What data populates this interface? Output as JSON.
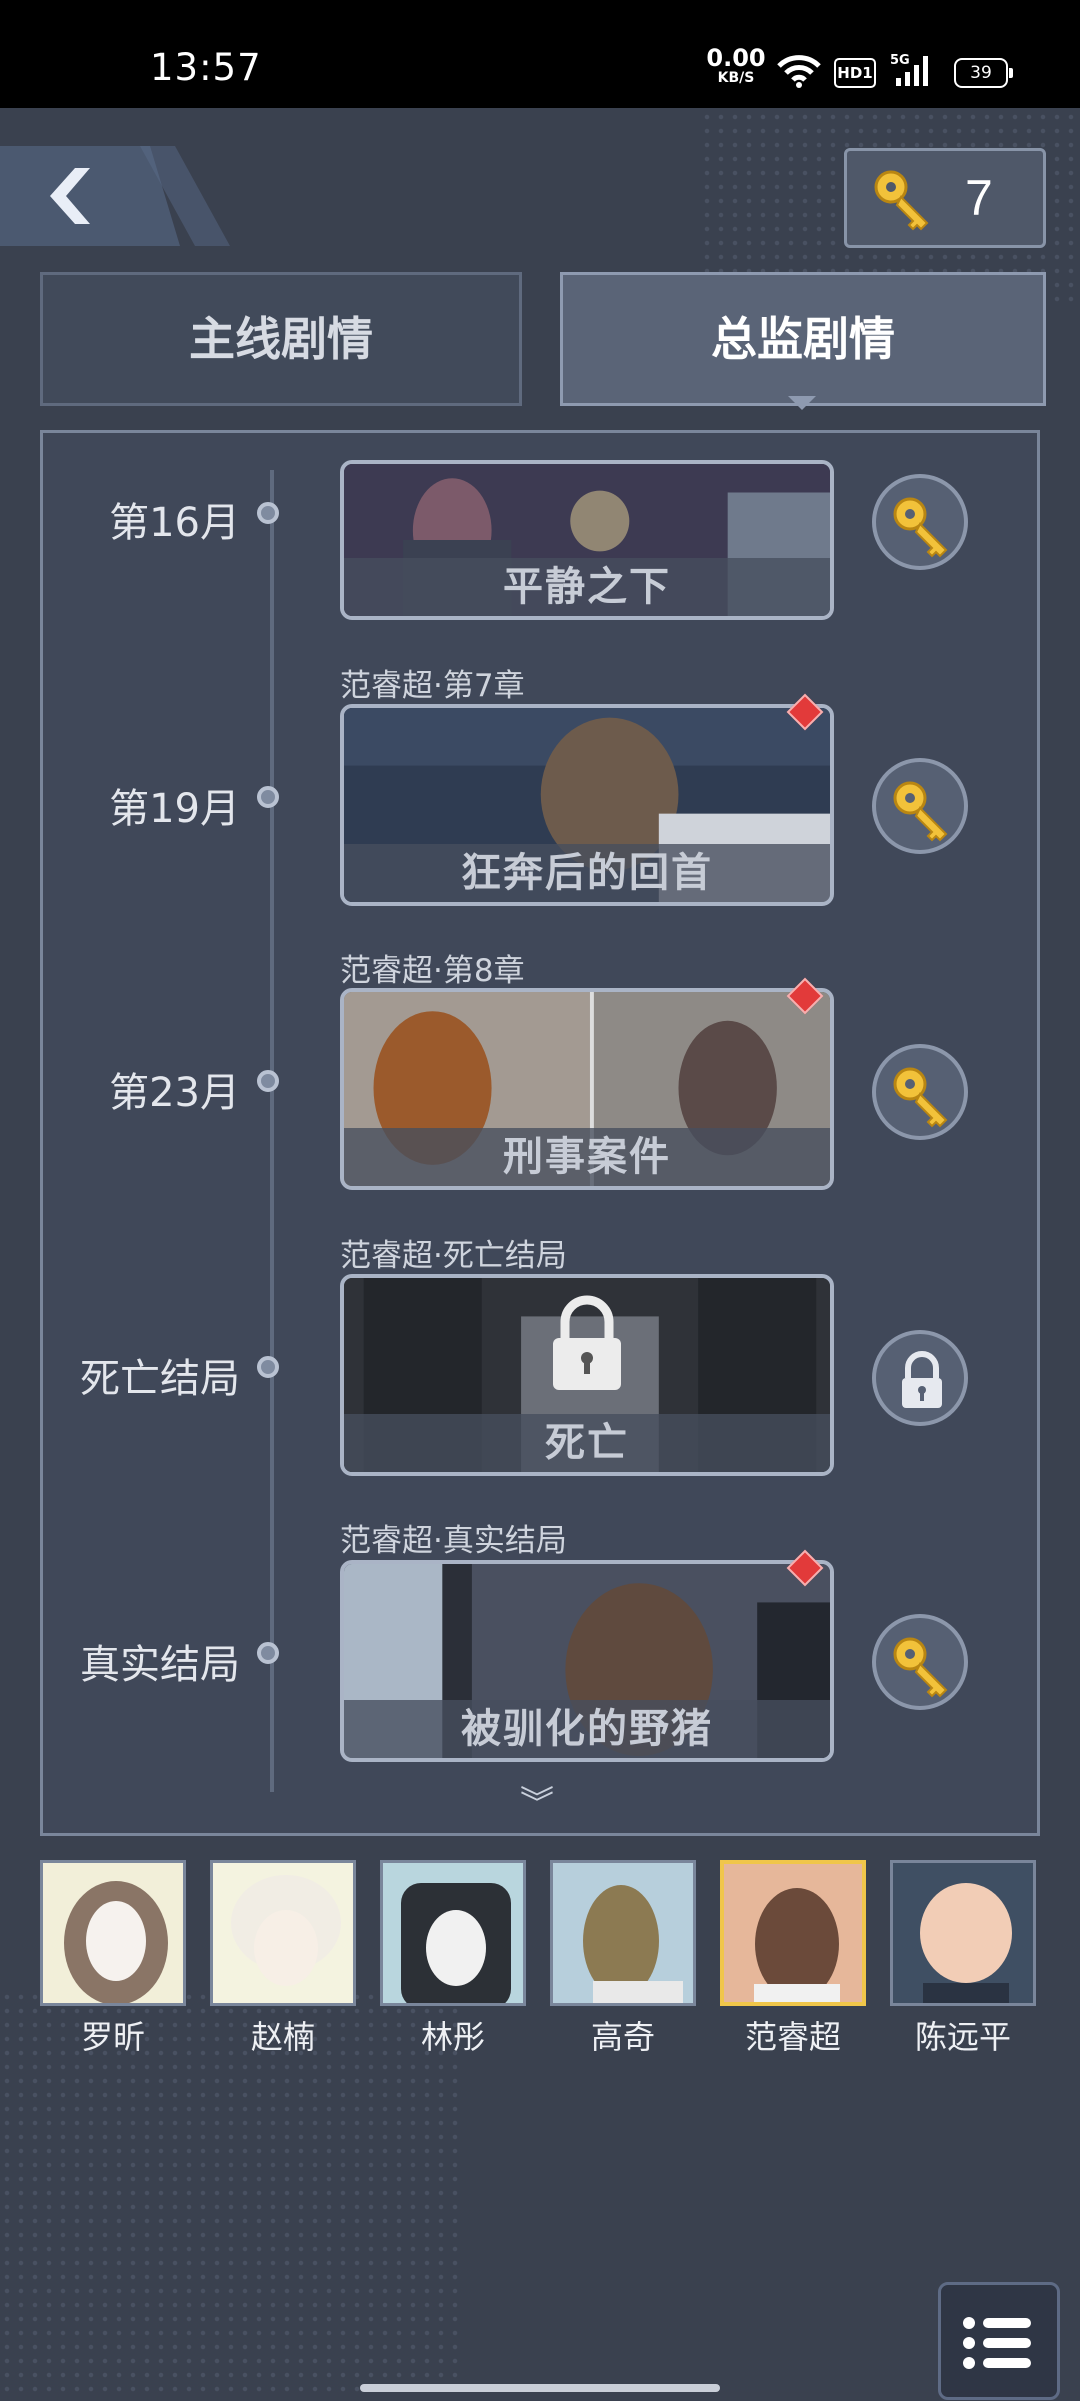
{
  "status_bar": {
    "time": "13:57",
    "net_speed": "0.00",
    "net_unit": "KB/S",
    "hd": "HD1",
    "signal": "5G",
    "battery": "39"
  },
  "header": {
    "key_count": "7"
  },
  "tabs": [
    {
      "label": "主线剧情",
      "active": false
    },
    {
      "label": "总监剧情",
      "active": true
    }
  ],
  "timeline": [
    {
      "month": "第16月",
      "subtitle": "",
      "title": "平静之下",
      "locked": false,
      "new": false
    },
    {
      "month": "第19月",
      "subtitle": "范睿超·第7章",
      "title": "狂奔后的回首",
      "locked": false,
      "new": true
    },
    {
      "month": "第23月",
      "subtitle": "范睿超·第8章",
      "title": "刑事案件",
      "locked": false,
      "new": true
    },
    {
      "month": "死亡结局",
      "subtitle": "范睿超·死亡结局",
      "title": "死亡",
      "locked": true,
      "new": false
    },
    {
      "month": "真实结局",
      "subtitle": "范睿超·真实结局",
      "title": "被驯化的野猪",
      "locked": false,
      "new": true
    }
  ],
  "more_indicator": "︾",
  "characters": [
    {
      "name": "罗昕",
      "selected": false
    },
    {
      "name": "赵楠",
      "selected": false
    },
    {
      "name": "林彤",
      "selected": false
    },
    {
      "name": "高奇",
      "selected": false
    },
    {
      "name": "范睿超",
      "selected": true
    },
    {
      "name": "陈远平",
      "selected": false
    }
  ],
  "colors": {
    "background": "#3a414f",
    "panel": "#404859",
    "accent_gold": "#f0c64a",
    "new_badge": "#e23a3a"
  },
  "icons": {
    "back": "chevron-left-icon",
    "key": "key-icon",
    "lock": "lock-icon",
    "menu": "list-menu-icon"
  }
}
